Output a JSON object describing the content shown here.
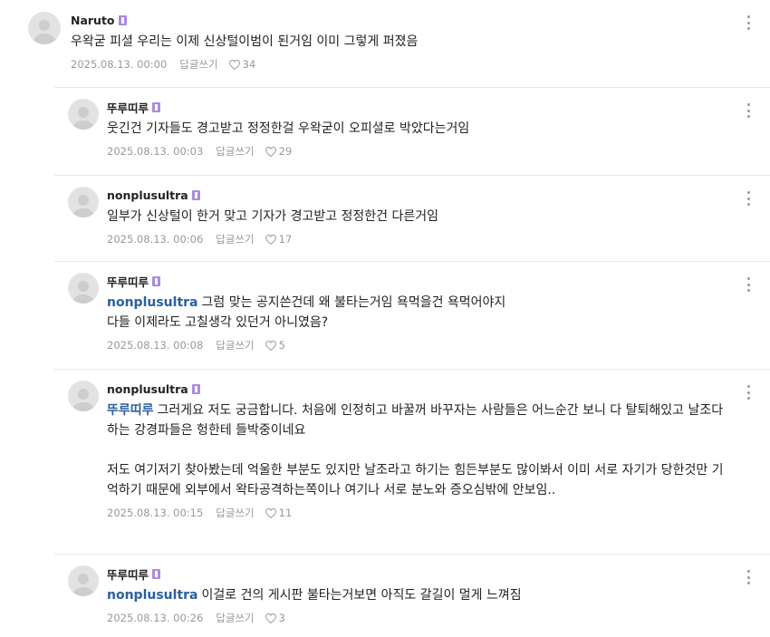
{
  "comments": [
    {
      "author": "Naruto",
      "text": "우왁굳 피셜 우리는 이제 신상털이범이 된거임 이미 그렇게 퍼졌음",
      "time": "2025.08.13. 00:00",
      "reply_label": "답글쓰기",
      "likes": "34"
    },
    {
      "author": "뚜루띠루",
      "text": "웃긴건 기자들도 경고받고 정정한걸 우왁굳이 오피셜로 박았다는거임",
      "time": "2025.08.13. 00:03",
      "reply_label": "답글쓰기",
      "likes": "29"
    },
    {
      "author": "nonplusultra",
      "text": "일부가 신상털이 한거 맞고 기자가 경고받고 정정한건 다른거임",
      "time": "2025.08.13. 00:06",
      "reply_label": "답글쓰기",
      "likes": "17"
    },
    {
      "author": "뚜루띠루",
      "mention": "nonplusultra",
      "text": "그럼 맞는 공지쓴건데 왜 불타는거임 욕먹을건 욕먹어야지\n다들 이제라도 고칠생각 있던거 아니였음?",
      "time": "2025.08.13. 00:08",
      "reply_label": "답글쓰기",
      "likes": "5"
    },
    {
      "author": "nonplusultra",
      "mention": "뚜루띠루",
      "text": "그러게요 저도 궁금합니다. 처음에 인정히고 바꿀꺼 바꾸자는 사람들은 어느순간 보니 다 탈퇴해있고 날조다 하는 강경파들은 헝한테 들박중이네요\n\n저도 여기저기 찾아봤는데 억울한 부분도 있지만 날조라고 하기는 힘든부분도 많이봐서 이미 서로 자기가 당한것만 기억하기 때문에 외부에서 왁타공격하는쪽이나 여기나 서로 분노와 증오심밖에 안보임..",
      "time": "2025.08.13. 00:15",
      "reply_label": "답글쓰기",
      "likes": "11"
    },
    {
      "author": "뚜루띠루",
      "mention": "nonplusultra",
      "text": "이걸로 건의 게시판 불타는거보면 아직도 갈길이 멀게 느껴짐",
      "time": "2025.08.13. 00:26",
      "reply_label": "답글쓰기",
      "likes": "3"
    }
  ]
}
